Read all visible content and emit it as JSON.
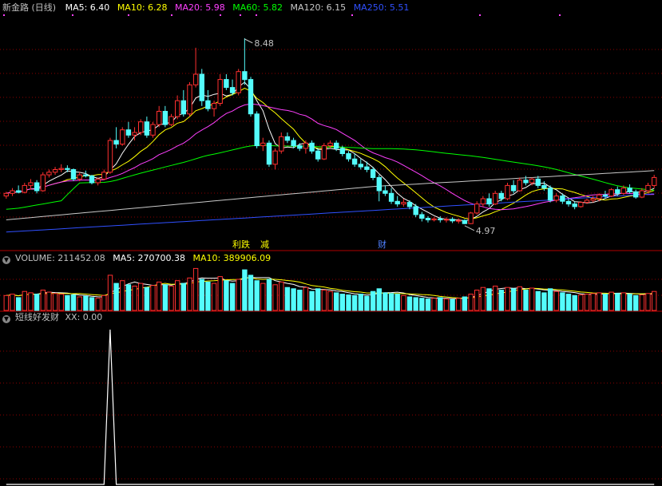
{
  "header": {
    "title": "新金路 (日线)",
    "ma": [
      {
        "label": "MA5: 6.40",
        "color": "#ffffff"
      },
      {
        "label": "MA10: 6.28",
        "color": "#ffff00"
      },
      {
        "label": "MA20: 5.98",
        "color": "#ff40ff"
      },
      {
        "label": "MA60: 5.82",
        "color": "#00ff00"
      },
      {
        "label": "MA120: 6.15",
        "color": "#c8c8c8"
      },
      {
        "label": "MA250: 5.51",
        "color": "#3050ff"
      }
    ]
  },
  "volume_header": {
    "label": "VOLUME: 211452.08",
    "ma5": "MA5: 270700.38",
    "ma10": "MA10: 389906.09"
  },
  "indicator_header": {
    "name": "短线好发财",
    "value": "XX: 0.00"
  },
  "annotations": {
    "high": "8.48",
    "low": "4.97",
    "events": [
      {
        "text": "利跌",
        "color": "#ffff00"
      },
      {
        "text": "减",
        "color": "#ffff00"
      },
      {
        "text": "财",
        "color": "#5080ff"
      }
    ]
  },
  "colors": {
    "up": "#ff3030",
    "down": "#54fcfc",
    "grid": "#8b0000",
    "ma5": "#ffffff",
    "ma10": "#ffff00",
    "ma20": "#ff40ff",
    "ma60": "#00ff00",
    "ma120": "#c8c8c8",
    "ma250": "#3050ff"
  },
  "chart_data": {
    "type": "candlestick",
    "ylim": [
      4.5,
      8.9
    ],
    "candles": [
      [
        5.5,
        5.58,
        5.45,
        5.55
      ],
      [
        5.55,
        5.65,
        5.5,
        5.6
      ],
      [
        5.6,
        5.7,
        5.55,
        5.57
      ],
      [
        5.57,
        5.75,
        5.55,
        5.7
      ],
      [
        5.7,
        5.82,
        5.62,
        5.75
      ],
      [
        5.75,
        5.8,
        5.55,
        5.6
      ],
      [
        5.6,
        5.95,
        5.58,
        5.9
      ],
      [
        5.9,
        6.0,
        5.85,
        5.95
      ],
      [
        5.95,
        6.05,
        5.9,
        6.0
      ],
      [
        6.0,
        6.1,
        5.95,
        6.02
      ],
      [
        6.02,
        6.08,
        5.95,
        6.0
      ],
      [
        6.0,
        6.02,
        5.78,
        5.82
      ],
      [
        5.82,
        5.95,
        5.78,
        5.9
      ],
      [
        5.9,
        5.98,
        5.85,
        5.88
      ],
      [
        5.88,
        5.9,
        5.72,
        5.75
      ],
      [
        5.75,
        5.85,
        5.7,
        5.82
      ],
      [
        5.82,
        6.0,
        5.8,
        5.95
      ],
      [
        5.95,
        6.6,
        5.92,
        6.55
      ],
      [
        6.55,
        6.8,
        6.4,
        6.48
      ],
      [
        6.48,
        6.8,
        6.45,
        6.75
      ],
      [
        6.75,
        6.9,
        6.6,
        6.65
      ],
      [
        6.65,
        6.8,
        6.55,
        6.7
      ],
      [
        6.7,
        6.95,
        6.65,
        6.9
      ],
      [
        6.9,
        7.0,
        6.6,
        6.65
      ],
      [
        6.65,
        6.9,
        6.6,
        6.85
      ],
      [
        6.85,
        7.2,
        6.8,
        7.1
      ],
      [
        7.1,
        7.2,
        6.8,
        6.85
      ],
      [
        6.85,
        7.05,
        6.82,
        7.0
      ],
      [
        7.0,
        7.4,
        6.95,
        7.3
      ],
      [
        7.3,
        7.5,
        7.0,
        7.05
      ],
      [
        7.05,
        7.65,
        7.0,
        7.6
      ],
      [
        7.6,
        8.3,
        7.55,
        7.8
      ],
      [
        7.8,
        7.9,
        7.2,
        7.3
      ],
      [
        7.3,
        7.5,
        7.1,
        7.15
      ],
      [
        7.15,
        7.3,
        7.0,
        7.25
      ],
      [
        7.25,
        7.8,
        7.2,
        7.7
      ],
      [
        7.7,
        7.8,
        7.5,
        7.55
      ],
      [
        7.55,
        7.7,
        7.4,
        7.45
      ],
      [
        7.45,
        7.9,
        7.4,
        7.85
      ],
      [
        7.85,
        8.48,
        7.6,
        7.7
      ],
      [
        7.7,
        7.75,
        7.0,
        7.05
      ],
      [
        7.05,
        7.1,
        6.4,
        6.45
      ],
      [
        6.45,
        6.6,
        6.35,
        6.5
      ],
      [
        6.5,
        6.55,
        6.05,
        6.1
      ],
      [
        6.1,
        6.4,
        6.0,
        6.35
      ],
      [
        6.35,
        6.7,
        6.3,
        6.62
      ],
      [
        6.62,
        6.7,
        6.5,
        6.55
      ],
      [
        6.55,
        6.6,
        6.4,
        6.45
      ],
      [
        6.45,
        6.5,
        6.35,
        6.4
      ],
      [
        6.4,
        6.55,
        6.3,
        6.5
      ],
      [
        6.5,
        6.55,
        6.3,
        6.35
      ],
      [
        6.35,
        6.4,
        6.15,
        6.2
      ],
      [
        6.2,
        6.5,
        6.18,
        6.45
      ],
      [
        6.45,
        6.55,
        6.4,
        6.5
      ],
      [
        6.5,
        6.55,
        6.35,
        6.4
      ],
      [
        6.4,
        6.45,
        6.25,
        6.3
      ],
      [
        6.3,
        6.35,
        6.15,
        6.2
      ],
      [
        6.2,
        6.3,
        6.05,
        6.1
      ],
      [
        6.1,
        6.2,
        6.0,
        6.05
      ],
      [
        6.05,
        6.15,
        5.95,
        6.0
      ],
      [
        6.0,
        6.05,
        5.8,
        5.85
      ],
      [
        5.85,
        5.9,
        5.4,
        5.6
      ],
      [
        5.6,
        5.7,
        5.5,
        5.55
      ],
      [
        5.55,
        5.65,
        5.35,
        5.4
      ],
      [
        5.4,
        5.5,
        5.3,
        5.35
      ],
      [
        5.35,
        5.45,
        5.3,
        5.38
      ],
      [
        5.38,
        5.42,
        5.25,
        5.3
      ],
      [
        5.3,
        5.35,
        5.1,
        5.15
      ],
      [
        5.15,
        5.2,
        5.02,
        5.08
      ],
      [
        5.08,
        5.12,
        5.0,
        5.05
      ],
      [
        5.05,
        5.1,
        5.02,
        5.07
      ],
      [
        5.07,
        5.12,
        5.0,
        5.05
      ],
      [
        5.05,
        5.1,
        5.0,
        5.06
      ],
      [
        5.06,
        5.1,
        4.99,
        5.03
      ],
      [
        5.03,
        5.08,
        4.98,
        5.04
      ],
      [
        5.04,
        5.06,
        4.97,
        4.98
      ],
      [
        4.98,
        5.2,
        4.97,
        5.18
      ],
      [
        5.18,
        5.4,
        5.15,
        5.35
      ],
      [
        5.35,
        5.5,
        5.3,
        5.45
      ],
      [
        5.45,
        5.55,
        5.3,
        5.35
      ],
      [
        5.35,
        5.6,
        5.33,
        5.55
      ],
      [
        5.55,
        5.6,
        5.4,
        5.45
      ],
      [
        5.45,
        5.75,
        5.42,
        5.7
      ],
      [
        5.7,
        5.8,
        5.55,
        5.6
      ],
      [
        5.6,
        5.85,
        5.58,
        5.8
      ],
      [
        5.8,
        5.88,
        5.7,
        5.75
      ],
      [
        5.75,
        5.85,
        5.7,
        5.82
      ],
      [
        5.82,
        5.88,
        5.65,
        5.7
      ],
      [
        5.7,
        5.78,
        5.6,
        5.65
      ],
      [
        5.65,
        5.7,
        5.38,
        5.42
      ],
      [
        5.42,
        5.55,
        5.38,
        5.5
      ],
      [
        5.5,
        5.55,
        5.35,
        5.4
      ],
      [
        5.4,
        5.45,
        5.3,
        5.35
      ],
      [
        5.35,
        5.4,
        5.25,
        5.3
      ],
      [
        5.3,
        5.4,
        5.28,
        5.38
      ],
      [
        5.38,
        5.45,
        5.35,
        5.42
      ],
      [
        5.42,
        5.5,
        5.38,
        5.45
      ],
      [
        5.45,
        5.55,
        5.4,
        5.52
      ],
      [
        5.52,
        5.6,
        5.45,
        5.5
      ],
      [
        5.5,
        5.65,
        5.48,
        5.62
      ],
      [
        5.62,
        5.68,
        5.5,
        5.55
      ],
      [
        5.55,
        5.7,
        5.52,
        5.65
      ],
      [
        5.65,
        5.72,
        5.55,
        5.58
      ],
      [
        5.58,
        5.62,
        5.45,
        5.48
      ],
      [
        5.48,
        5.65,
        5.46,
        5.6
      ],
      [
        5.6,
        5.75,
        5.55,
        5.7
      ],
      [
        5.7,
        5.9,
        5.65,
        5.85
      ]
    ],
    "volume": [
      110,
      120,
      95,
      140,
      130,
      120,
      150,
      135,
      125,
      120,
      110,
      115,
      100,
      105,
      95,
      90,
      110,
      260,
      200,
      220,
      190,
      180,
      200,
      170,
      185,
      210,
      190,
      180,
      220,
      200,
      240,
      310,
      230,
      210,
      200,
      250,
      220,
      200,
      230,
      300,
      260,
      220,
      200,
      230,
      190,
      210,
      170,
      160,
      150,
      170,
      140,
      160,
      150,
      140,
      130,
      120,
      115,
      110,
      120,
      105,
      140,
      160,
      130,
      125,
      120,
      110,
      100,
      95,
      90,
      85,
      90,
      95,
      85,
      80,
      90,
      100,
      120,
      150,
      170,
      160,
      180,
      150,
      170,
      160,
      175,
      150,
      165,
      140,
      130,
      160,
      140,
      130,
      120,
      110,
      115,
      120,
      125,
      130,
      120,
      135,
      125,
      130,
      120,
      110,
      115,
      125,
      140
    ],
    "volume_ylim": [
      0,
      330
    ],
    "indicator": {
      "spike_index": 17,
      "value_max": 1,
      "value": 0.0
    }
  }
}
